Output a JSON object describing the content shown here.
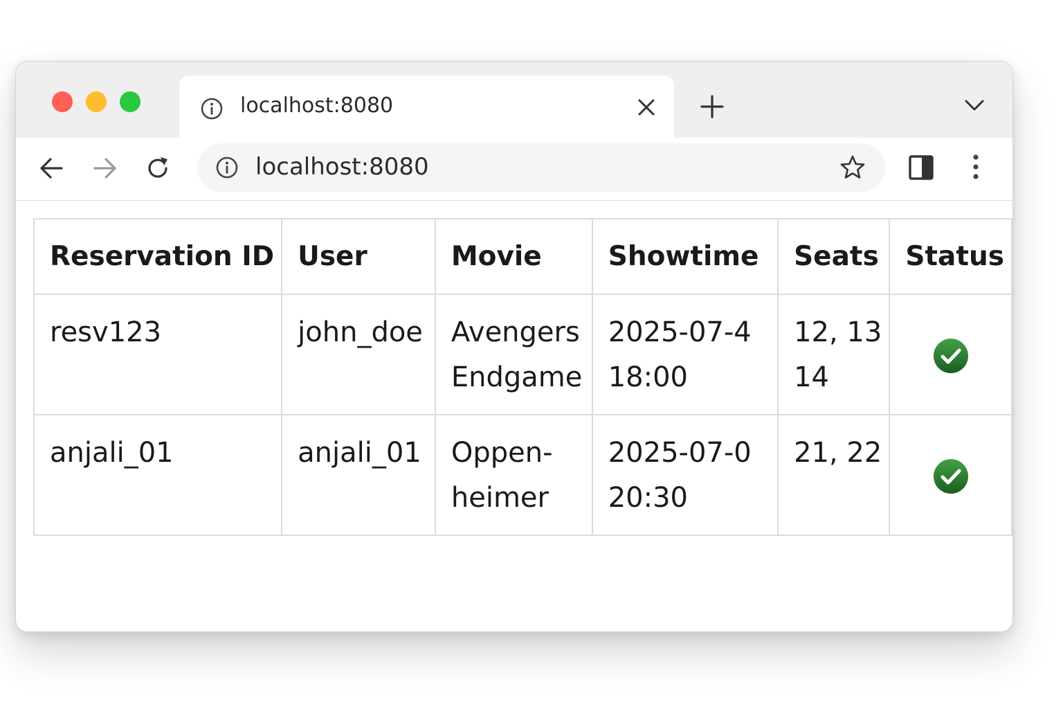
{
  "browser": {
    "tab_title": "localhost:8080",
    "url": "localhost:8080",
    "icons": {
      "tab_info": "info-icon",
      "tab_close": "close-icon",
      "new_tab": "plus-icon",
      "tab_menu": "chevron-down-icon",
      "back": "arrow-left-icon",
      "forward": "arrow-right-icon",
      "reload": "reload-icon",
      "omnibox_info": "info-icon",
      "bookmark": "star-icon",
      "side_panel": "side-panel-icon",
      "menu": "kebab-menu-icon"
    },
    "colors": {
      "close": "#fe5f57",
      "minimize": "#febc2e",
      "maximize": "#28c840"
    }
  },
  "table": {
    "headers": [
      "Reservation ID",
      "User",
      "Movie",
      "Showtime",
      "Seats",
      "Status"
    ],
    "rows": [
      {
        "id": "resv123",
        "user": "john_doe",
        "movie": [
          "Avengers",
          "Endgame"
        ],
        "showtime": [
          "2025-07-4",
          "18:00"
        ],
        "seats": [
          "12, 13",
          "14"
        ],
        "status": "check-icon"
      },
      {
        "id": "anjali_01",
        "user": "anjali_01",
        "movie": [
          "Oppen-",
          "heimer"
        ],
        "showtime": [
          "2025-07-0",
          "20:30"
        ],
        "seats": [
          "21, 22"
        ],
        "status": "check-icon"
      }
    ],
    "status_color": "#2e7d32"
  }
}
